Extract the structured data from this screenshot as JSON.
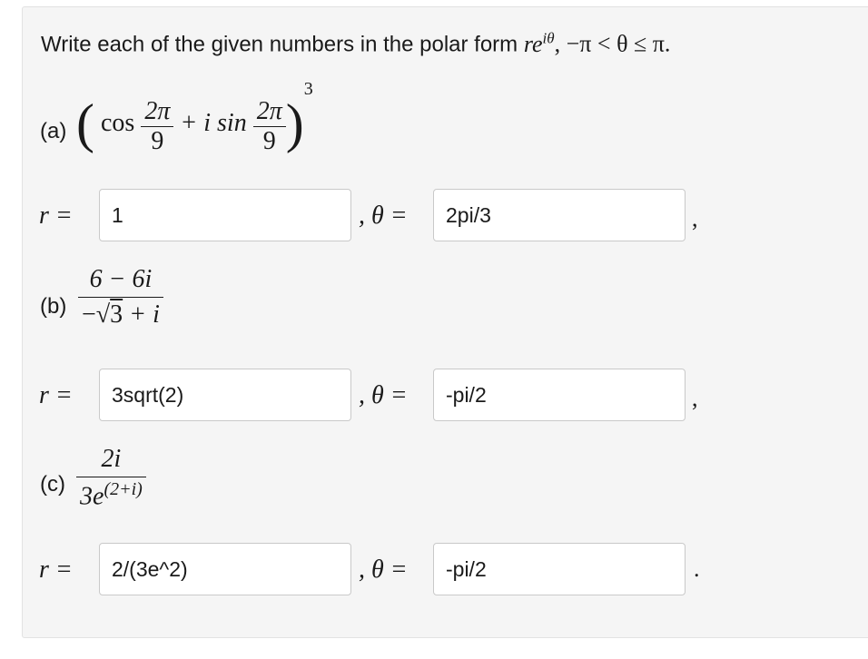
{
  "prompt": {
    "text": "Write each of the given numbers in the polar form",
    "form": "re",
    "form_exp": "iθ",
    "range": ", −π < θ ≤ π."
  },
  "parts": [
    {
      "label": "(a)",
      "cos": "cos",
      "num": "2π",
      "den": "9",
      "plus_isin": "+ i sin",
      "power": "3",
      "r_label": "r =",
      "r_value": "1",
      "theta_label": ", θ =",
      "theta_value": "2pi/3",
      "end": ","
    },
    {
      "label": "(b)",
      "num": "6 − 6i",
      "den_minus": "−",
      "den_root": "3",
      "den_tail": "+ i",
      "r_label": "r =",
      "r_value": "3sqrt(2)",
      "theta_label": ", θ =",
      "theta_value": "-pi/2",
      "end": ","
    },
    {
      "label": "(c)",
      "num": "2i",
      "den_base": "3e",
      "den_exp": "(2+i)",
      "r_label": "r =",
      "r_value": "2/(3e^2)",
      "theta_label": ", θ =",
      "theta_value": "-pi/2",
      "end": "."
    }
  ]
}
